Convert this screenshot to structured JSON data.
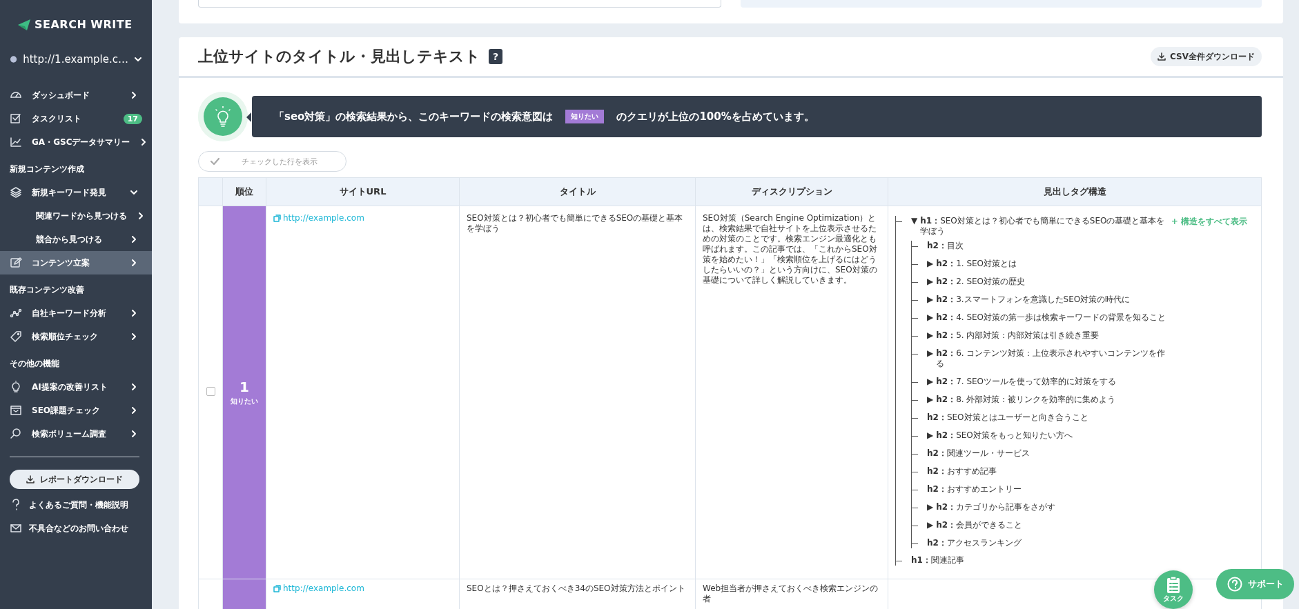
{
  "sidebar": {
    "logo": "SEARCH WRITE",
    "site": "http://1.example.c…",
    "sections": [
      {
        "items": [
          {
            "label": "ダッシュボード",
            "selected": false
          },
          {
            "label": "タスクリスト",
            "selected": false,
            "badge": "17"
          },
          {
            "label": "GA・GSCデータサマリー",
            "selected": false
          }
        ]
      },
      {
        "heading": "新規コンテンツ作成",
        "items": [
          {
            "label": "新規キーワード発見",
            "selected": false,
            "expanded": true,
            "children": [
              {
                "label": "関連ワードから見つける",
                "selected": false
              },
              {
                "label": "競合から見つける",
                "selected": false
              }
            ]
          },
          {
            "label": "コンテンツ立案",
            "selected": true
          }
        ]
      },
      {
        "heading": "既存コンテンツ改善",
        "items": [
          {
            "label": "自社キーワード分析",
            "selected": false
          },
          {
            "label": "検索順位チェック",
            "selected": false
          }
        ]
      },
      {
        "heading": "その他の機能",
        "items": [
          {
            "label": "AI提案の改善リスト",
            "selected": false
          },
          {
            "label": "SEO課題チェック",
            "selected": false
          },
          {
            "label": "検索ボリューム調査",
            "selected": false
          }
        ]
      }
    ],
    "report_button": "レポートダウンロード",
    "links": [
      {
        "label": "よくあるご質問・機能説明"
      },
      {
        "label": "不具合などのお問い合わせ"
      }
    ]
  },
  "panel": {
    "title": "上位サイトのタイトル・見出しテキスト",
    "help": "?",
    "csv_button": "CSV全件ダウンロード",
    "banner": {
      "before": "「seo対策」の検索結果から、このキーワードの検索意図は",
      "tag": "知りたい",
      "after": "のクエリが上位の100%を占めています。"
    },
    "filter_button": "チェックした行を表示",
    "table": {
      "columns": [
        "順位",
        "サイトURL",
        "タイトル",
        "ディスクリプション",
        "見出しタグ構造"
      ],
      "rows": [
        {
          "checked": false,
          "rank": "1",
          "intent": "知りたい",
          "url": "http://example.com",
          "title": "SEO対策とは？初心者でも簡単にできるSEOの基礎と基本を学ぼう",
          "description": "SEO対策（Search Engine Optimization）とは、検索結果で自社サイトを上位表示させるための対策のことです。検索エンジン最適化とも呼ばれます。この記事では、「これからSEO対策を始めたい！」「検索順位を上げるにはどうしたらいいの？」という方向けに、SEO対策の基礎について詳しく解説していきます。",
          "show_all": "+ 構造をすべて表示",
          "headings": [
            {
              "toggle": "▼",
              "text": "**h1：**SEO対策とは？初心者でも簡単にできるSEOの基礎と基本を学ぼう",
              "children": [
                {
                  "text": "**h2：**目次"
                },
                {
                  "toggle": "▶",
                  "text": "**h2：**1. SEO対策とは"
                },
                {
                  "toggle": "▶",
                  "text": "**h2：**2. SEO対策の歴史"
                },
                {
                  "toggle": "▶",
                  "text": "**h2：**3.スマートフォンを意識したSEO対策の時代に"
                },
                {
                  "toggle": "▶",
                  "text": "**h2：**4. SEO対策の第一歩は検索キーワードの背景を知ること"
                },
                {
                  "toggle": "▶",
                  "text": "**h2：**5. 内部対策：内部対策は引き続き重要"
                },
                {
                  "toggle": "▶",
                  "text": "**h2：**6. コンテンツ対策：上位表示されやすいコンテンツを作る"
                },
                {
                  "toggle": "▶",
                  "text": "**h2：**7. SEOツールを使って効率的に対策をする"
                },
                {
                  "toggle": "▶",
                  "text": "**h2：**8. 外部対策：被リンクを効率的に集めよう"
                },
                {
                  "text": "**h2：**SEO対策とはユーザーと向き合うこと"
                },
                {
                  "toggle": "▶",
                  "text": "**h2：**SEO対策をもっと知りたい方へ"
                },
                {
                  "text": "**h2：**関連ツール・サービス"
                },
                {
                  "text": "**h2：**おすすめ記事"
                },
                {
                  "text": "**h2：**おすすめエントリー"
                },
                {
                  "toggle": "▶",
                  "text": "**h2：**カテゴリから記事をさがす"
                },
                {
                  "toggle": "▶",
                  "text": "**h2：**会員ができること"
                },
                {
                  "text": "**h2：**アクセスランキング"
                }
              ]
            },
            {
              "text": "**h1：**関連記事"
            }
          ]
        },
        {
          "url": "http://example.com",
          "title": "SEOとは？押さえておくべき34のSEO対策方法とポイント",
          "description": "Web担当者が押さえておくべき検索エンジンの者"
        }
      ]
    }
  },
  "task_button": "タスク",
  "support_button": "サポート"
}
